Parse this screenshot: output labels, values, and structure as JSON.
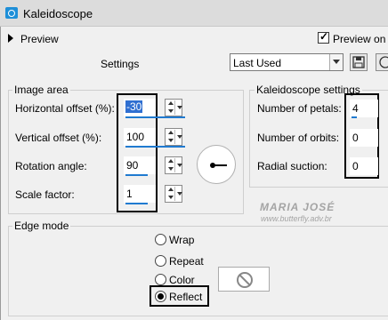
{
  "window": {
    "title": "Kaleidoscope"
  },
  "preview": {
    "label": "Preview",
    "preview_on_label": "Preview on I",
    "checked": true
  },
  "settings": {
    "label": "Settings",
    "preset_value": "Last Used"
  },
  "image_area": {
    "title": "Image area",
    "fields": [
      {
        "label": "Horizontal offset (%):",
        "value": "-30"
      },
      {
        "label": "Vertical offset (%):",
        "value": "100"
      },
      {
        "label": "Rotation angle:",
        "value": "90"
      },
      {
        "label": "Scale factor:",
        "value": "1"
      }
    ]
  },
  "kaleidoscope_settings": {
    "title": "Kaleidoscope settings",
    "fields": [
      {
        "label": "Number of petals:",
        "value": "4"
      },
      {
        "label": "Number of orbits:",
        "value": "0"
      },
      {
        "label": "Radial suction:",
        "value": "0"
      }
    ]
  },
  "edge_mode": {
    "title": "Edge mode",
    "options": [
      "Wrap",
      "Repeat",
      "Color",
      "Reflect"
    ],
    "selected": "Reflect"
  },
  "watermark": {
    "line1": "MARIA JOSÉ",
    "line2": "www.butterfly.adv.br"
  },
  "icons": [
    "app-icon",
    "expand-arrow-icon",
    "checkbox-icon",
    "dropdown-arrow-icon",
    "save-icon",
    "reset-icon",
    "spin-icon",
    "angle-dial-icon",
    "no-color-icon"
  ]
}
